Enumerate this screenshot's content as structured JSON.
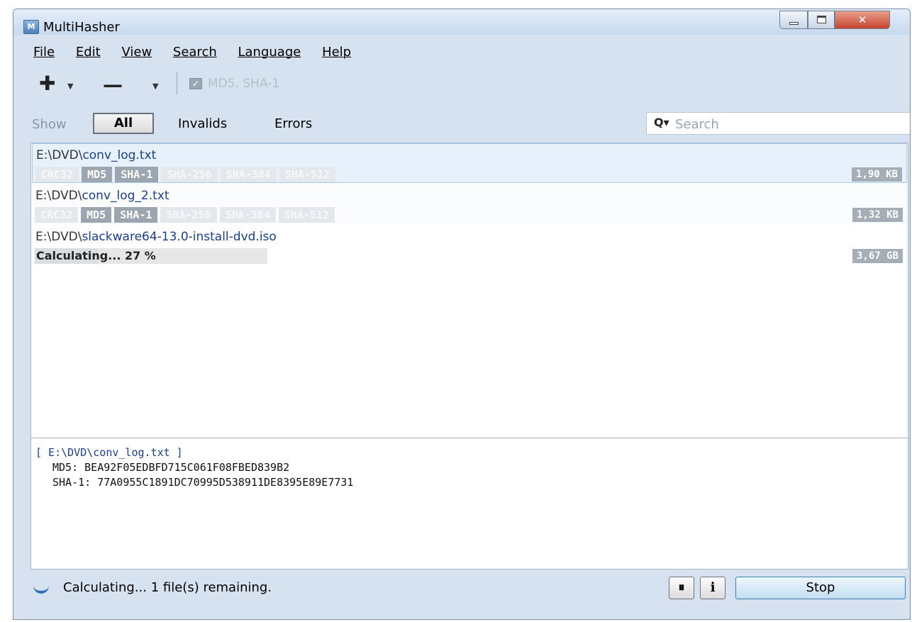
{
  "window": {
    "title": "MultiHasher",
    "app_icon_glyph": "M"
  },
  "menu": [
    "File",
    "Edit",
    "View",
    "Search",
    "Language",
    "Help"
  ],
  "toolbar": {
    "add_icon": "plus-icon",
    "remove_icon": "minus-icon",
    "algorithms_label": "MD5, SHA-1"
  },
  "filter": {
    "show_label": "Show",
    "options": [
      "All",
      "Invalids",
      "Errors"
    ],
    "selected": "All"
  },
  "search": {
    "placeholder": "Search"
  },
  "files": [
    {
      "dir": "E:\\DVD\\",
      "name": "conv_log.txt",
      "size": "1,90 KB",
      "tags": [
        {
          "label": "CRC32",
          "enabled": false
        },
        {
          "label": "MD5",
          "enabled": true
        },
        {
          "label": "SHA-1",
          "enabled": true
        },
        {
          "label": "SHA-256",
          "enabled": false
        },
        {
          "label": "SHA-384",
          "enabled": false
        },
        {
          "label": "SHA-512",
          "enabled": false
        }
      ]
    },
    {
      "dir": "E:\\DVD\\",
      "name": "conv_log_2.txt",
      "size": "1,32 KB",
      "tags": [
        {
          "label": "CRC32",
          "enabled": false
        },
        {
          "label": "MD5",
          "enabled": true
        },
        {
          "label": "SHA-1",
          "enabled": true
        },
        {
          "label": "SHA-256",
          "enabled": false
        },
        {
          "label": "SHA-384",
          "enabled": false
        },
        {
          "label": "SHA-512",
          "enabled": false
        }
      ]
    },
    {
      "dir": "E:\\DVD\\",
      "name": "slackware64-13.0-install-dvd.iso",
      "size": "3,67 GB",
      "progress_text": "Calculating... 27 %",
      "progress": 27
    }
  ],
  "details": {
    "header": "[ E:\\DVD\\conv_log.txt ]",
    "lines": [
      "MD5: BEA92F05EDBFD715C061F08FBED839B2",
      "SHA-1: 77A0955C1891DC70995D538911DE8395E89E7731"
    ]
  },
  "status": {
    "text": "Calculating... 1 file(s) remaining.",
    "stop_label": "Stop"
  },
  "colors": {
    "window_bg": "#d6e2ef",
    "link_blue": "#1a3f8f",
    "tag_enabled": "#9ca6b1",
    "selection": "#e7f1fb"
  }
}
